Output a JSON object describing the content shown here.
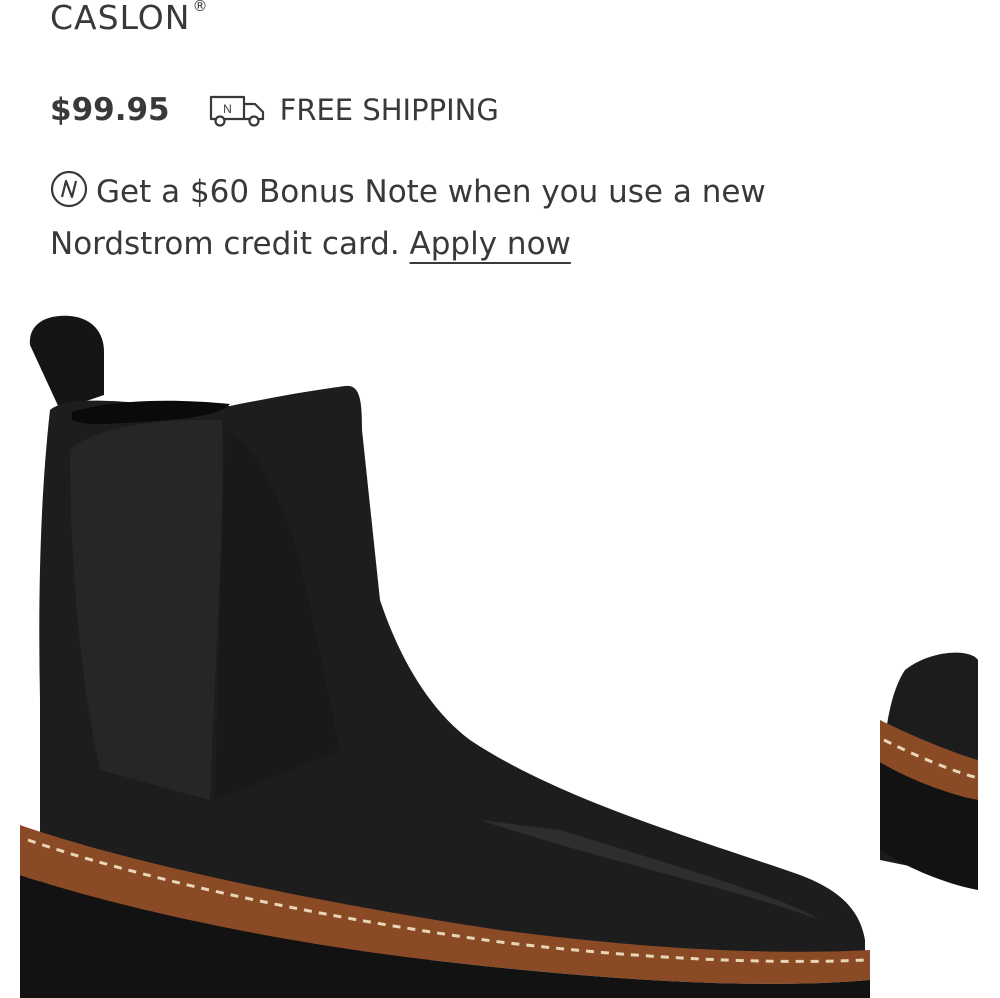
{
  "product": {
    "brand": "CASLON",
    "brand_mark": "®",
    "price": "$99.95",
    "shipping_label": "FREE SHIPPING",
    "truck_icon": "truck-icon",
    "bonus_icon": "nordstrom-note-icon",
    "bonus_text": "Get a $60 Bonus Note when you use a new Nordstrom credit card.",
    "apply_link": "Apply now"
  },
  "image": {
    "subject": "black leather chelsea boot with lug sole",
    "colors": {
      "leather": "#1c1c1c",
      "welt": "#8a4a26",
      "stitch": "#e8d6b8",
      "background": "#ffffff"
    }
  }
}
